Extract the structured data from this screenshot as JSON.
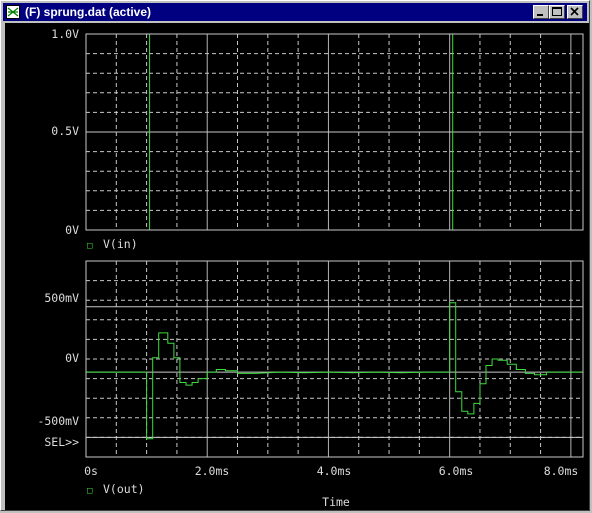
{
  "window": {
    "title": "(F) sprung.dat (active)",
    "icons": {
      "app": "probe-app-icon",
      "minimize": "minimize-icon",
      "maximize": "maximize-icon",
      "close": "close-icon"
    }
  },
  "colors": {
    "background": "#000000",
    "trace": "#3ddc3d",
    "grid": "#c8c8c8",
    "text": "#dcdcdc",
    "titlebar": "#000080"
  },
  "plot_top": {
    "y_ticks": [
      "1.0V",
      "0.5V",
      "0V"
    ],
    "legend_marker": "□",
    "legend": "V(in)"
  },
  "plot_bottom": {
    "y_ticks": [
      "500mV",
      "0V",
      "-500mV"
    ],
    "sel_label": "SEL>>",
    "legend_marker": "□",
    "legend": "V(out)"
  },
  "x_axis": {
    "ticks": [
      "0s",
      "2.0ms",
      "4.0ms",
      "6.0ms",
      "8.0ms"
    ],
    "label": "Time"
  },
  "chart_data": [
    {
      "type": "line",
      "xlim": [
        0,
        8.2
      ],
      "ylim": [
        0,
        1.0
      ],
      "grid": true,
      "series": [
        {
          "name": "V(in)",
          "x": [
            0,
            1.05,
            1.05,
            6.05,
            6.05,
            8.2
          ],
          "y": [
            0,
            0,
            1.0,
            1.0,
            0,
            0
          ]
        }
      ]
    },
    {
      "type": "line",
      "xlim": [
        0,
        8.2
      ],
      "ylim": [
        -650,
        850
      ],
      "grid": true,
      "series": [
        {
          "name": "V(out)",
          "x": [
            0,
            1.0,
            1.0,
            1.1,
            1.1,
            1.2,
            1.2,
            1.35,
            1.35,
            1.45,
            1.45,
            1.55,
            1.55,
            1.65,
            1.65,
            1.75,
            1.75,
            1.85,
            1.85,
            2.0,
            2.0,
            2.15,
            2.15,
            2.3,
            2.3,
            2.5,
            2.5,
            2.8,
            3.2,
            3.6,
            4.0,
            4.4,
            4.8,
            5.2,
            5.6,
            6.0,
            6.0,
            6.1,
            6.1,
            6.2,
            6.2,
            6.3,
            6.3,
            6.4,
            6.4,
            6.5,
            6.5,
            6.6,
            6.6,
            6.7,
            6.7,
            6.8,
            6.8,
            6.95,
            6.95,
            7.1,
            7.1,
            7.25,
            7.25,
            7.4,
            7.4,
            7.6,
            7.6,
            7.8,
            8.0,
            8.2
          ],
          "y": [
            0,
            0,
            -510,
            -510,
            110,
            110,
            300,
            300,
            220,
            220,
            110,
            110,
            -80,
            -80,
            -100,
            -100,
            -80,
            -80,
            -50,
            -50,
            0,
            0,
            20,
            20,
            10,
            10,
            -10,
            -10,
            0,
            -5,
            0,
            -5,
            0,
            -5,
            0,
            0,
            530,
            530,
            -150,
            -150,
            -300,
            -300,
            -320,
            -320,
            -240,
            -240,
            -90,
            -90,
            50,
            50,
            100,
            100,
            90,
            90,
            60,
            60,
            20,
            20,
            -10,
            -10,
            -20,
            -20,
            0,
            0,
            0,
            0
          ]
        }
      ]
    }
  ]
}
